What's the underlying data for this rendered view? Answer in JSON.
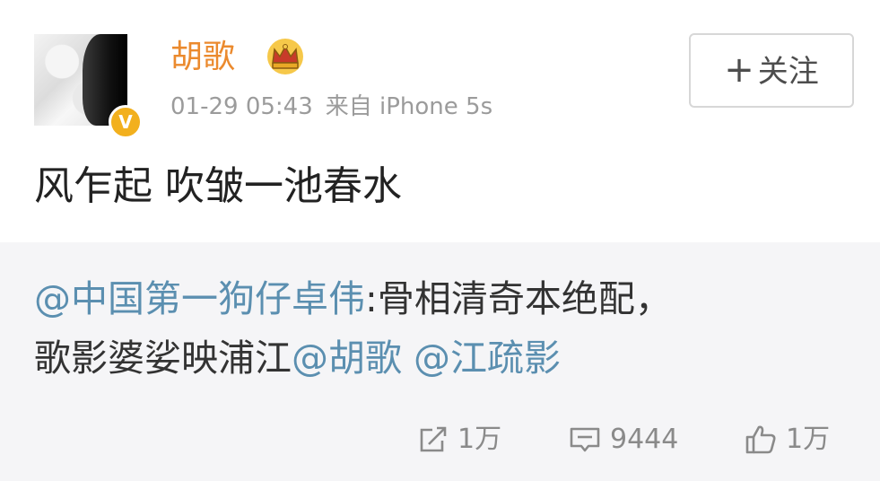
{
  "user": {
    "name": "胡歌",
    "timestamp": "01-29 05:43",
    "source": "来自 iPhone 5s",
    "verified_badge": "V"
  },
  "follow_button": {
    "plus": "+",
    "label": "关注"
  },
  "post": {
    "text": "风乍起 吹皱一池春水"
  },
  "repost": {
    "mention_1": "@中国第一狗仔卓伟",
    "text_1": ":骨相清奇本绝配，",
    "text_2": "歌影婆娑映浦江",
    "mention_2": "@胡歌",
    "mention_3": "@江疏影"
  },
  "actions": {
    "repost_count": "1万",
    "comment_count": "9444",
    "like_count": "1万"
  },
  "icons": [
    "crown-icon",
    "verified-icon",
    "repost-icon",
    "comment-icon",
    "like-icon"
  ],
  "colors": {
    "username": "#eb8a2e",
    "mention": "#5b8fb0",
    "verified": "#f2b01e"
  }
}
